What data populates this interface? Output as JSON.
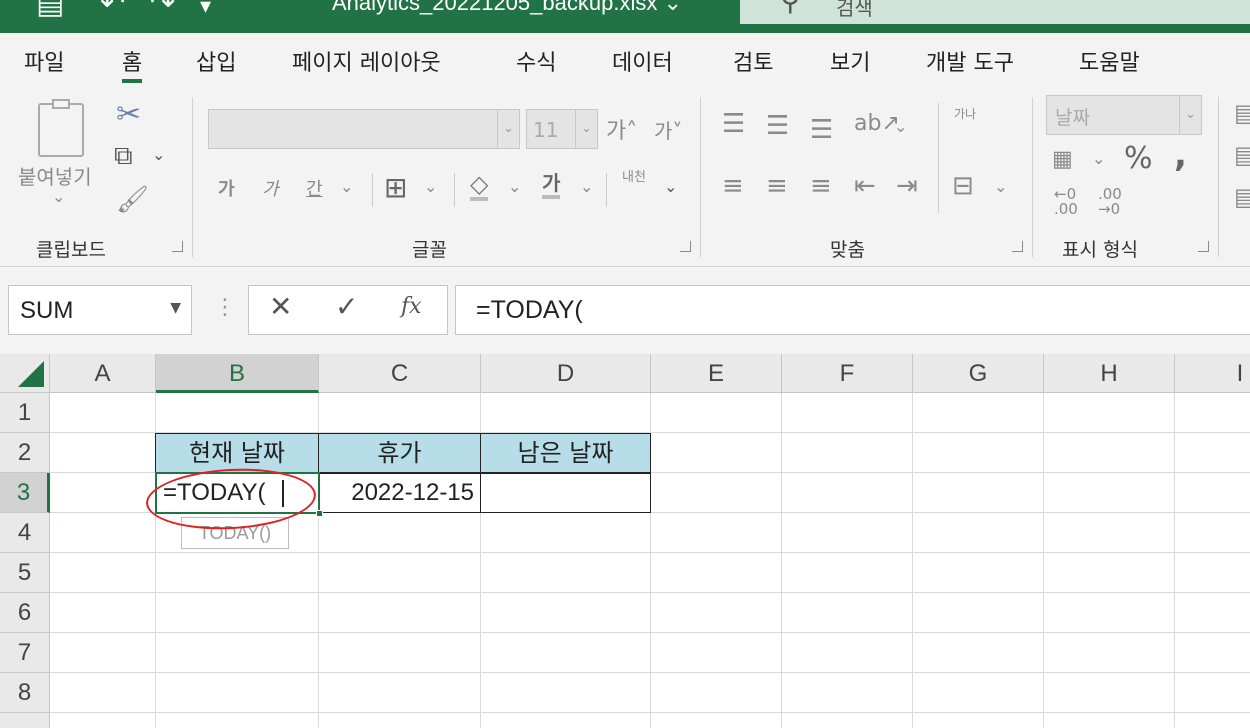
{
  "titlebar": {
    "filename": "Analytics_20221205_backup.xlsx",
    "search_placeholder": "검색"
  },
  "menu": {
    "tabs": [
      {
        "label": "파일"
      },
      {
        "label": "홈",
        "active": true
      },
      {
        "label": "삽입"
      },
      {
        "label": "페이지 레이아웃"
      },
      {
        "label": "수식"
      },
      {
        "label": "데이터"
      },
      {
        "label": "검토"
      },
      {
        "label": "보기"
      },
      {
        "label": "개발 도구"
      },
      {
        "label": "도움말"
      }
    ]
  },
  "ribbon": {
    "clipboard": {
      "paste_label": "붙여넣기",
      "group_label": "클립보드"
    },
    "font": {
      "group_label": "글꼴",
      "font_name": "",
      "font_size": "11",
      "wrap_label": "내천"
    },
    "alignment": {
      "group_label": "맞춤",
      "vertical_text": "가나"
    },
    "number": {
      "group_label": "표시 형식",
      "format_value": "날짜",
      "percent": "%",
      "comma": ","
    }
  },
  "formula_bar": {
    "name_box": "SUM",
    "cancel_glyph": "✕",
    "enter_glyph": "✓",
    "fx_glyph": "fx",
    "formula": "=TODAY("
  },
  "grid": {
    "columns": [
      "A",
      "B",
      "C",
      "D",
      "E",
      "F",
      "G",
      "H",
      "I"
    ],
    "rows": [
      "1",
      "2",
      "3",
      "4",
      "5",
      "6",
      "7",
      "8"
    ],
    "selected_column": "B",
    "selected_row": "3",
    "headers": [
      "현재 날짜",
      "휴가",
      "남은 날짜"
    ],
    "row3": {
      "b": "=TODAY(",
      "c": "2022-12-15",
      "d": ""
    },
    "tooltip": "TODAY()"
  },
  "colors": {
    "accent": "#217346",
    "header_fill": "#b7dee8",
    "annotation": "#e02020"
  }
}
